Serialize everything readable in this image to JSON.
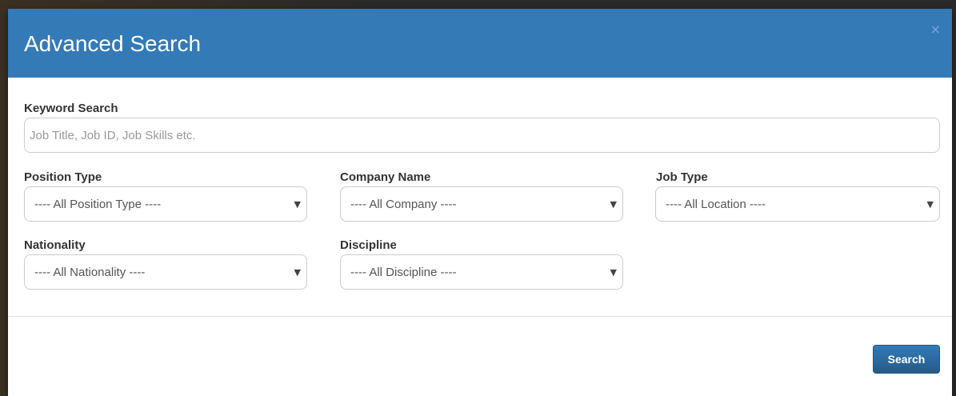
{
  "modal": {
    "title": "Advanced Search",
    "close_label": "×"
  },
  "keyword": {
    "label": "Keyword Search",
    "placeholder": "Job Title, Job ID, Job Skills etc.",
    "value": ""
  },
  "filters": {
    "position_type": {
      "label": "Position Type",
      "selected": "---- All Position Type ----"
    },
    "company_name": {
      "label": "Company Name",
      "selected": "---- All Company ----"
    },
    "job_type": {
      "label": "Job Type",
      "selected": "---- All Location ----"
    },
    "nationality": {
      "label": "Nationality",
      "selected": "---- All Nationality ----"
    },
    "discipline": {
      "label": "Discipline",
      "selected": "---- All Discipline ----"
    }
  },
  "select_arrow": "▼",
  "footer": {
    "search_label": "Search"
  },
  "colors": {
    "header": "#337ab7",
    "button": "#2e6da4"
  }
}
